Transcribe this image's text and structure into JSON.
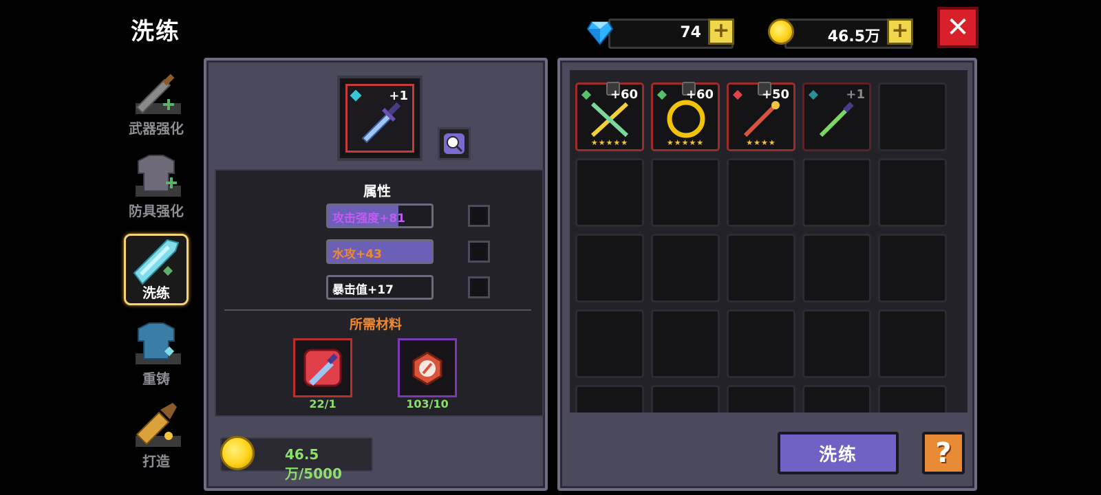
{
  "header": {
    "title": "洗练"
  },
  "currency": {
    "gems": "74",
    "gold": "46.5万",
    "plus_symbol": "+",
    "close_symbol": "✕"
  },
  "sidebar": {
    "items": [
      {
        "label": "武器强化",
        "icon": "sword-upgrade-icon",
        "active": false
      },
      {
        "label": "防具强化",
        "icon": "armor-upgrade-icon",
        "active": false
      },
      {
        "label": "洗练",
        "icon": "refine-crystal-icon",
        "active": true
      },
      {
        "label": "重铸",
        "icon": "recast-armor-icon",
        "active": false
      },
      {
        "label": "打造",
        "icon": "forge-hammer-icon",
        "active": false
      }
    ]
  },
  "equipment": {
    "level": "+1",
    "icon": "sword-icon"
  },
  "attributes": {
    "title": "属性",
    "rows": [
      {
        "text": "攻击强度+81",
        "color": "#c15bf2",
        "fill_fraction": 0.68
      },
      {
        "text": "水攻+43",
        "color": "#f08a30",
        "fill_fraction": 1.0
      },
      {
        "text": "暴击值+17",
        "color": "#ffffff",
        "fill_fraction": 0.0
      }
    ]
  },
  "materials": {
    "title": "所需材料",
    "items": [
      {
        "count": "22/1",
        "icon": "sword-scroll-icon",
        "border": "#b8302c"
      },
      {
        "count": "103/10",
        "icon": "refine-stone-icon",
        "border": "#7a3ab6"
      }
    ]
  },
  "cost": {
    "text": "46.5万/5000"
  },
  "inventory": {
    "items": [
      {
        "badge": "+60",
        "gem_color": "#56c36a",
        "stars": "★★★★★",
        "icon": "crossed-swords-icon"
      },
      {
        "badge": "+60",
        "gem_color": "#56c36a",
        "stars": "★★★★★",
        "icon": "gold-ring-icon"
      },
      {
        "badge": "+50",
        "gem_color": "#e0404a",
        "stars": "★★★★",
        "icon": "fire-staff-icon"
      },
      {
        "badge": "+1",
        "gem_color": "#37c6d6",
        "stars": "",
        "icon": "green-sword-icon"
      }
    ]
  },
  "buttons": {
    "refine": "洗练",
    "help": "?"
  }
}
